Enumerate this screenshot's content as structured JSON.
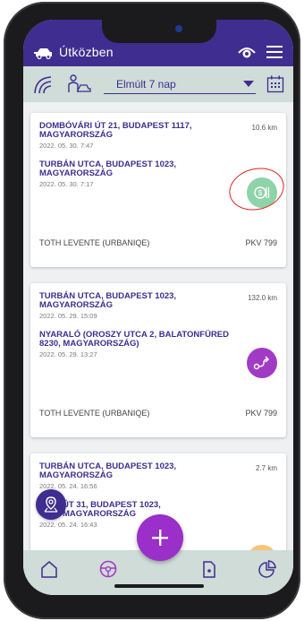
{
  "header": {
    "title": "Útközben"
  },
  "filter": {
    "period": "Elmúlt 7 nap"
  },
  "trips": [
    {
      "from_address": "DOMBÓVÁRI ÚT 21, BUDAPEST 1117, MAGYARORSZÁG",
      "from_time": "2022. 05. 30. 7:47",
      "to_address": "TURBÁN UTCA, BUDAPEST 1023, MAGYARORSZÁG",
      "to_time": "2022. 05. 30. 7:17",
      "distance": "10.6 km",
      "driver": "TOTH LEVENTE (URBANIQE)",
      "plate": "PKV 799",
      "badge": "money-icon",
      "badge_color": "#8fd3a8"
    },
    {
      "from_address": "TURBÁN UTCA, BUDAPEST 1023, MAGYARORSZÁG",
      "from_time": "2022. 05. 29. 15:09",
      "to_address": "NYARALÓ (OROSZY UTCA 2, BALATONFÜRED 8230, MAGYARORSZÁG)",
      "to_time": "2022. 05. 29. 13:27",
      "distance": "132.0 km",
      "driver": "TOTH LEVENTE (URBANIQE)",
      "plate": "PKV 799",
      "badge": "route-icon",
      "badge_color": "#a23bc4"
    },
    {
      "from_address": "TURBÁN UTCA, BUDAPEST 1023, MAGYARORSZÁG",
      "from_time": "2022. 05. 24. 16:56",
      "to_address": "ÚT 31, BUDAPEST 1023, MAGYARORSZÁG",
      "to_time": "2022. 05. 24. 16:43",
      "distance": "2.7 km",
      "badge": "hand-icon",
      "badge_color": "#f7c479"
    }
  ],
  "colors": {
    "primary": "#3f2d8f",
    "accent": "#9a2fc9",
    "bar": "#cfdcd8"
  }
}
